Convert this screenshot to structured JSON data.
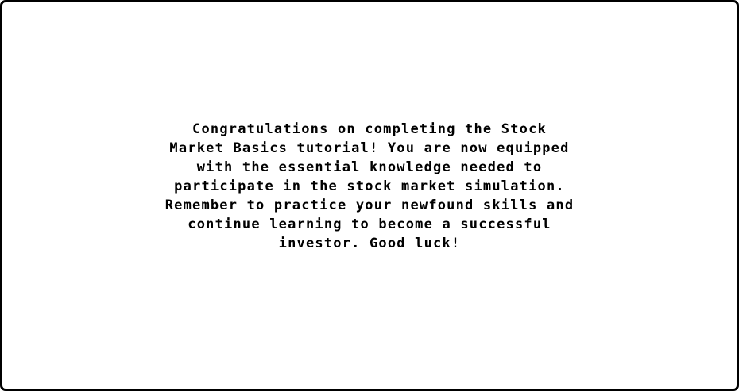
{
  "dialog": {
    "message": "Congratulations on completing the Stock\nMarket Basics tutorial! You are now equipped\nwith the essential knowledge needed to\nparticipate in the stock market simulation.\nRemember to practice your newfound skills and\ncontinue learning to become a successful\ninvestor. Good luck!"
  },
  "colors": {
    "background": "#ffffff",
    "border": "#000000",
    "text": "#000000"
  }
}
